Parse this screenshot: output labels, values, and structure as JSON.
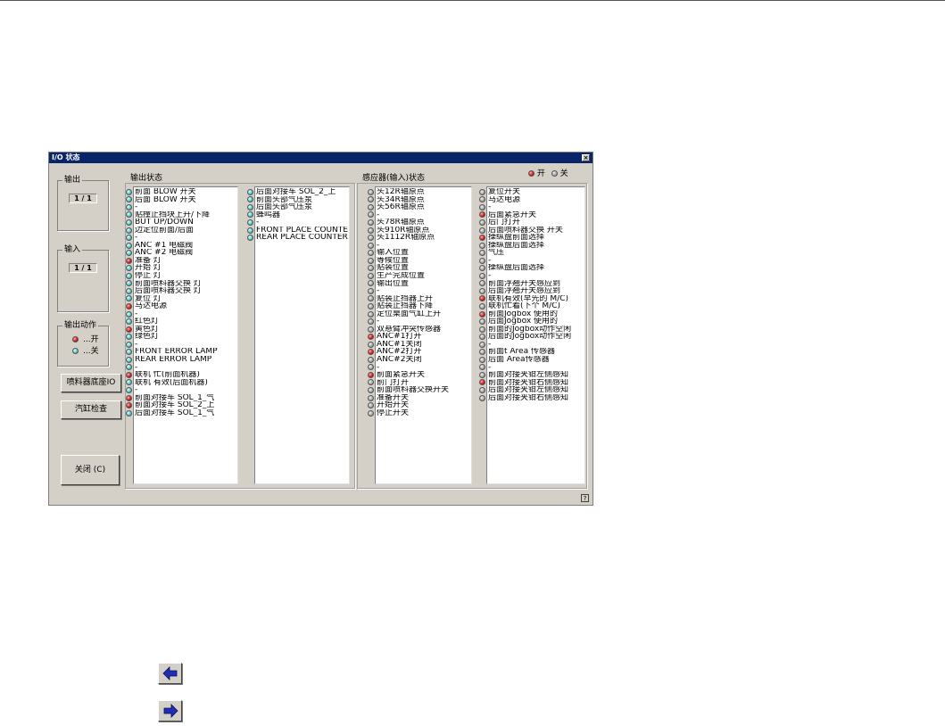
{
  "dialog": {
    "title": "I/O 状态",
    "close_glyph": "×",
    "help_glyph": "?"
  },
  "output_counter": {
    "title": "输出",
    "value": "1 / 1"
  },
  "input_counter": {
    "title": "输入",
    "value": "1 / 1"
  },
  "output_action": {
    "title": "输出动作",
    "on_label": "...开",
    "off_label": "...关"
  },
  "buttons": {
    "spray_base_io": "喷料器底座IO",
    "cylinder_check": "汽缸检查",
    "close": "关闭 (C)"
  },
  "panels": {
    "output_status_label": "输出状态",
    "sensor_status_label": "感应器(输入)状态",
    "legend_on": "开",
    "legend_off": "关"
  },
  "colors": {
    "on": "#e01010",
    "off_gray": "#a0a0a0",
    "output_off": "#3fc3c3",
    "title_bar": "#0a246a"
  },
  "output_list_1": [
    {
      "text": "前面 BLOW 开关",
      "state": "cyan"
    },
    {
      "text": "后面 BLOW 开关",
      "state": "cyan"
    },
    {
      "text": "-",
      "state": "cyan"
    },
    {
      "text": "贴撞止挡块上升/下降",
      "state": "cyan"
    },
    {
      "text": "BUT UP/DOWN",
      "state": "cyan"
    },
    {
      "text": "边定位前面/后面",
      "state": "cyan"
    },
    {
      "text": "-",
      "state": "cyan"
    },
    {
      "text": "ANC #1 电磁阀",
      "state": "cyan"
    },
    {
      "text": "ANC #2 电磁阀",
      "state": "cyan"
    },
    {
      "text": "准备 灯",
      "state": "red"
    },
    {
      "text": "开始 灯",
      "state": "cyan"
    },
    {
      "text": "停止 灯",
      "state": "cyan"
    },
    {
      "text": "前面喷料器交换 灯",
      "state": "cyan"
    },
    {
      "text": "后面喷料器交换 灯",
      "state": "cyan"
    },
    {
      "text": "复位 灯",
      "state": "cyan"
    },
    {
      "text": "马达电源",
      "state": "red"
    },
    {
      "text": "-",
      "state": "cyan"
    },
    {
      "text": "红色灯",
      "state": "cyan"
    },
    {
      "text": "黄色灯",
      "state": "red"
    },
    {
      "text": "绿色灯",
      "state": "cyan"
    },
    {
      "text": "-",
      "state": "cyan"
    },
    {
      "text": "FRONT ERROR LAMP",
      "state": "cyan"
    },
    {
      "text": "REAR ERROR LAMP",
      "state": "cyan"
    },
    {
      "text": "-",
      "state": "cyan"
    },
    {
      "text": "联机 忙(前面机器)",
      "state": "red"
    },
    {
      "text": "联机 有效(后面机器)",
      "state": "cyan"
    },
    {
      "text": "-",
      "state": "cyan"
    },
    {
      "text": "前面对接车 SOL_1_气",
      "state": "red"
    },
    {
      "text": "前面对接车 SOL_2_上",
      "state": "red"
    },
    {
      "text": "后面对接车 SOL_1_气",
      "state": "cyan"
    }
  ],
  "output_list_2": [
    {
      "text": "后面对接车 SOL_2_上",
      "state": "cyan"
    },
    {
      "text": "前面头部气压泵",
      "state": "cyan"
    },
    {
      "text": "后面头部气压泵",
      "state": "cyan"
    },
    {
      "text": "蜂鸣器",
      "state": "cyan"
    },
    {
      "text": "-",
      "state": "cyan"
    },
    {
      "text": "FRONT PLACE COUNTE",
      "state": "cyan"
    },
    {
      "text": "REAR PLACE COUNTER",
      "state": "cyan"
    }
  ],
  "sensor_list_1": [
    {
      "text": "头12R轴原点",
      "state": "gray"
    },
    {
      "text": "头34R轴原点",
      "state": "gray"
    },
    {
      "text": "头56R轴原点",
      "state": "gray"
    },
    {
      "text": "-",
      "state": "gray"
    },
    {
      "text": "头78R轴原点",
      "state": "gray"
    },
    {
      "text": "头910R轴原点",
      "state": "gray"
    },
    {
      "text": "头1112R轴原点",
      "state": "gray"
    },
    {
      "text": "-",
      "state": "gray"
    },
    {
      "text": "输入位置",
      "state": "gray"
    },
    {
      "text": "等候位置",
      "state": "gray"
    },
    {
      "text": "贴装位置",
      "state": "gray"
    },
    {
      "text": "生产完成位置",
      "state": "gray"
    },
    {
      "text": "输出位置",
      "state": "gray"
    },
    {
      "text": "-",
      "state": "gray"
    },
    {
      "text": "贴装止挡器上升",
      "state": "gray"
    },
    {
      "text": "贴装止挡器下降",
      "state": "gray"
    },
    {
      "text": "定位桌面气缸上升",
      "state": "gray"
    },
    {
      "text": "-",
      "state": "gray"
    },
    {
      "text": "双悬臂冲突传感器",
      "state": "gray"
    },
    {
      "text": "ANC#1打开",
      "state": "red"
    },
    {
      "text": "ANC#1关闭",
      "state": "gray"
    },
    {
      "text": "ANC#2打开",
      "state": "red"
    },
    {
      "text": "ANC#2关闭",
      "state": "gray"
    },
    {
      "text": "-",
      "state": "gray"
    },
    {
      "text": "前面紧急开关",
      "state": "red"
    },
    {
      "text": "前门打开",
      "state": "gray"
    },
    {
      "text": "前面喷料器交换开关",
      "state": "gray"
    },
    {
      "text": "准备开关",
      "state": "gray"
    },
    {
      "text": "开始开关",
      "state": "gray"
    },
    {
      "text": "停止开关",
      "state": "gray"
    }
  ],
  "sensor_list_2": [
    {
      "text": "复位开关",
      "state": "gray"
    },
    {
      "text": "马达电源",
      "state": "gray"
    },
    {
      "text": "-",
      "state": "gray"
    },
    {
      "text": "后面紧急开关",
      "state": "red"
    },
    {
      "text": "后门打开",
      "state": "gray"
    },
    {
      "text": "后面喷料器交换 开关",
      "state": "gray"
    },
    {
      "text": "操纵盘前面选择",
      "state": "red"
    },
    {
      "text": "操纵盘后面选择",
      "state": "gray"
    },
    {
      "text": "气压",
      "state": "gray"
    },
    {
      "text": "-",
      "state": "gray"
    },
    {
      "text": "操纵盘后面选择",
      "state": "gray"
    },
    {
      "text": "-",
      "state": "gray"
    },
    {
      "text": "前面浮翘开关感应到",
      "state": "gray"
    },
    {
      "text": "后面浮翘开关感应到",
      "state": "gray"
    },
    {
      "text": "联机有效(早先的 M/C)",
      "state": "red"
    },
    {
      "text": "联机忙着(下个 M/C)",
      "state": "gray"
    },
    {
      "text": "前面Jogbox 使用的",
      "state": "red"
    },
    {
      "text": "后面Jogbox 使用的",
      "state": "gray"
    },
    {
      "text": "前面的Jogbox动作空闲",
      "state": "gray"
    },
    {
      "text": "后面的Jogbox动作空闲",
      "state": "gray"
    },
    {
      "text": "-",
      "state": "gray"
    },
    {
      "text": "前面t Area 传感器",
      "state": "gray"
    },
    {
      "text": "后面 Area传感器",
      "state": "gray"
    },
    {
      "text": "-",
      "state": "gray"
    },
    {
      "text": "前面对接夹钳左侧感知",
      "state": "gray"
    },
    {
      "text": "前面对接夹钳右侧感知",
      "state": "red"
    },
    {
      "text": "后面对接夹钳左侧感知",
      "state": "gray"
    },
    {
      "text": "后面对接夹钳右侧感知",
      "state": "gray"
    }
  ],
  "nav": {
    "back_icon": "left-arrow-icon",
    "forward_icon": "right-arrow-icon"
  }
}
